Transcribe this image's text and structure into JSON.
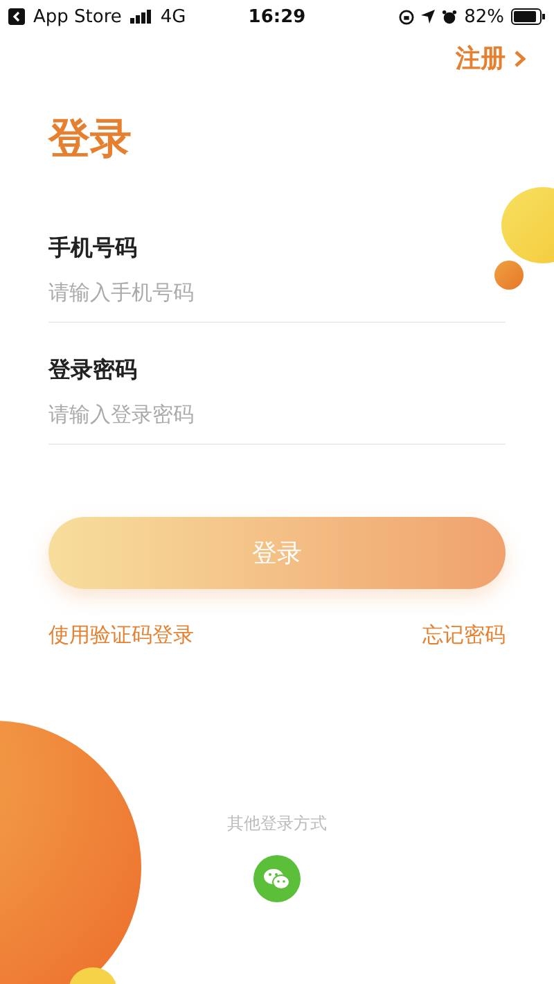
{
  "status_bar": {
    "back_app": "App Store",
    "network": "4G",
    "time": "16:29",
    "battery": "82%"
  },
  "register_link": {
    "label": "注册"
  },
  "title": "登录",
  "fields": [
    {
      "label": "手机号码",
      "placeholder": "请输入手机号码"
    },
    {
      "label": "登录密码",
      "placeholder": "请输入登录密码"
    }
  ],
  "login_button": "登录",
  "links": [
    "使用验证码登录",
    "忘记密码"
  ],
  "other_login": {
    "label": "其他登录方式"
  }
}
